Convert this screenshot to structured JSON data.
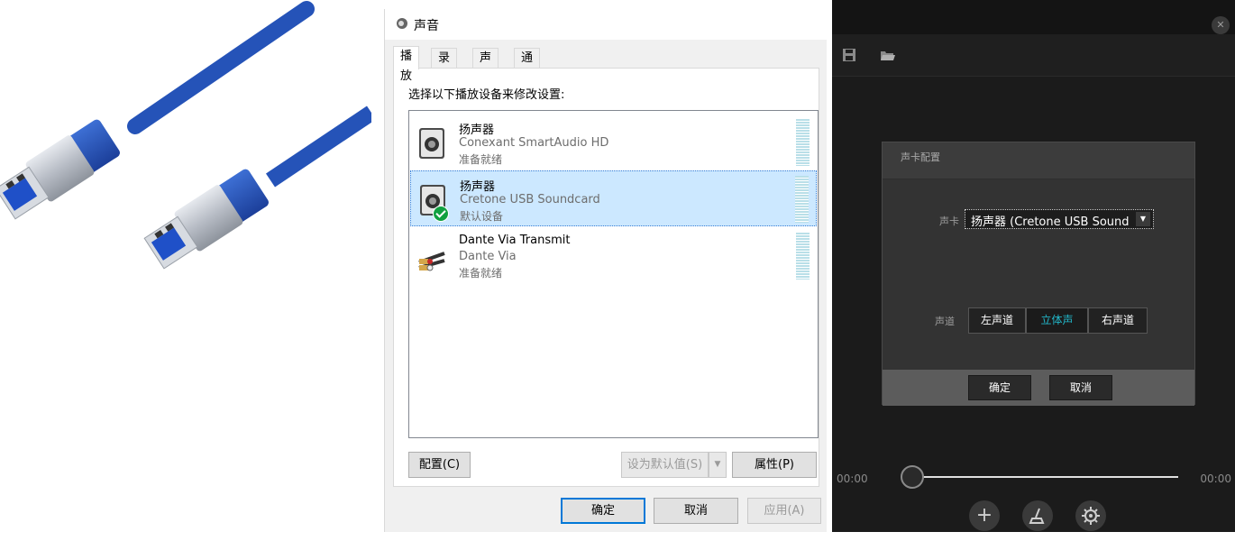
{
  "dialog": {
    "title": "声音",
    "tabs": [
      "播放",
      "录制",
      "声音",
      "通信"
    ],
    "active_tab": 0,
    "instruction": "选择以下播放设备来修改设置:",
    "devices": [
      {
        "name": "扬声器",
        "description": "Conexant SmartAudio HD",
        "status": "准备就绪",
        "icon": "speaker-icon",
        "selected": false,
        "default": false
      },
      {
        "name": "扬声器",
        "description": "Cretone USB Soundcard",
        "status": "默认设备",
        "icon": "speaker-icon",
        "selected": true,
        "default": true
      },
      {
        "name": "Dante Via Transmit",
        "description": "Dante Via",
        "status": "准备就绪",
        "icon": "rca-cable-icon",
        "selected": false,
        "default": false
      }
    ],
    "configure_btn": "配置(C)",
    "set_default_btn": "设为默认值(S)",
    "properties_btn": "属性(P)",
    "ok_btn": "确定",
    "cancel_btn": "取消",
    "apply_btn": "应用(A)"
  },
  "app": {
    "dialog_title": "声卡配置",
    "soundcard_label": "声卡",
    "soundcard_value": "扬声器 (Cretone USB Sound",
    "channel_label": "声道",
    "channels": [
      "左声道",
      "立体声",
      "右声道"
    ],
    "active_channel": 1,
    "ok_btn": "确定",
    "cancel_btn": "取消",
    "time_start": "00:00",
    "time_end": "00:00",
    "playback_progress": 0,
    "accent_color": "#22b6c8",
    "controls": [
      "plus-icon",
      "broom-icon",
      "gear-icon"
    ]
  }
}
